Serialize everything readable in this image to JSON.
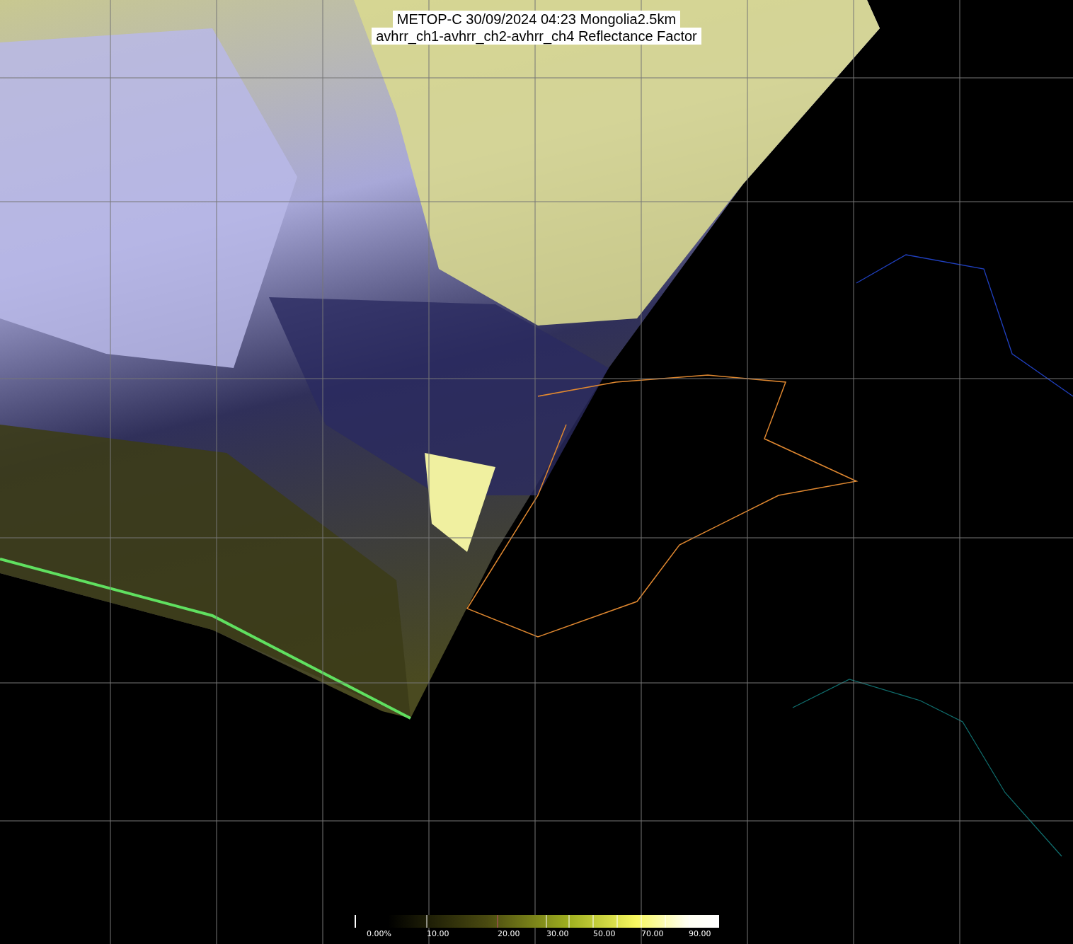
{
  "title": {
    "lines": [
      "METOP-C 30/09/2024 04:23 Mongolia2.5km",
      "avhrr_ch1-avhrr_ch2-avhrr_ch4 Reflectance Factor"
    ]
  },
  "legend": {
    "labels": [
      "0.00%",
      "10.00",
      "20.00",
      "30.00",
      "50.00",
      "70.00",
      "90.00"
    ]
  }
}
